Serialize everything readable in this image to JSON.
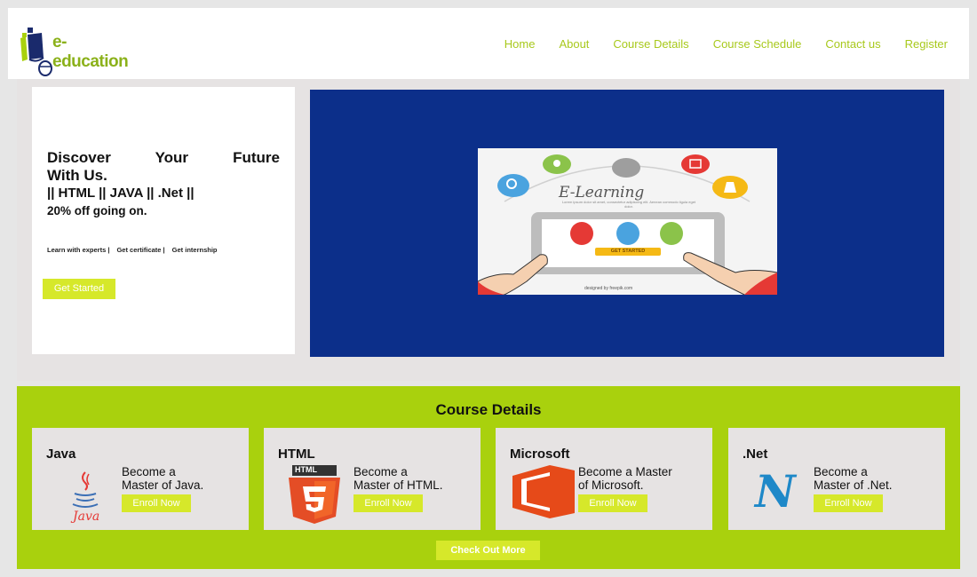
{
  "brand": {
    "name": "e-education"
  },
  "nav": {
    "items": [
      "Home",
      "About",
      "Course Details",
      "Course Schedule",
      "Contact us",
      "Register"
    ]
  },
  "hero": {
    "title_line1": "Discover Your Future",
    "title_line2": "With Us.",
    "subtitle": "|| HTML || JAVA || .Net ||",
    "offer": "20% off going on.",
    "tags": [
      "Learn with experts |",
      "Get certificate |",
      "Get internship"
    ],
    "cta": "Get Started",
    "image": {
      "title": "E-Learning",
      "caption": "Lorem ipsum dolor sit amet, consectetur adipiscing elit. Aenean commodo ligula eget dolor.",
      "button": "GET STARTED",
      "credit": "designed by freepik.com"
    }
  },
  "courses": {
    "title": "Course Details",
    "items": [
      {
        "name": "Java",
        "desc_line1": "Become a",
        "desc_line2": "Master of Java.",
        "button": "Enroll Now",
        "icon": "java-icon",
        "icon_label": "Java"
      },
      {
        "name": "HTML",
        "desc_line1": "Become a",
        "desc_line2": "Master of HTML.",
        "button": "Enroll Now",
        "icon": "html5-icon",
        "icon_label": "HTML"
      },
      {
        "name": "Microsoft",
        "desc_line1": "Become a Master",
        "desc_line2": "of Microsoft.",
        "button": "Enroll Now",
        "icon": "office-icon",
        "icon_label": ""
      },
      {
        "name": ".Net",
        "desc_line1": "Become a",
        "desc_line2": "Master of .Net.",
        "button": "Enroll Now",
        "icon": "dotnet-icon",
        "icon_label": "N"
      }
    ],
    "more": "Check Out More"
  },
  "colors": {
    "accent": "#a9d10d",
    "button": "#d6e82a",
    "nav_link": "#a8c91c",
    "hero_blue": "#0c2f8a",
    "panel_gray": "#e6e3e3"
  }
}
